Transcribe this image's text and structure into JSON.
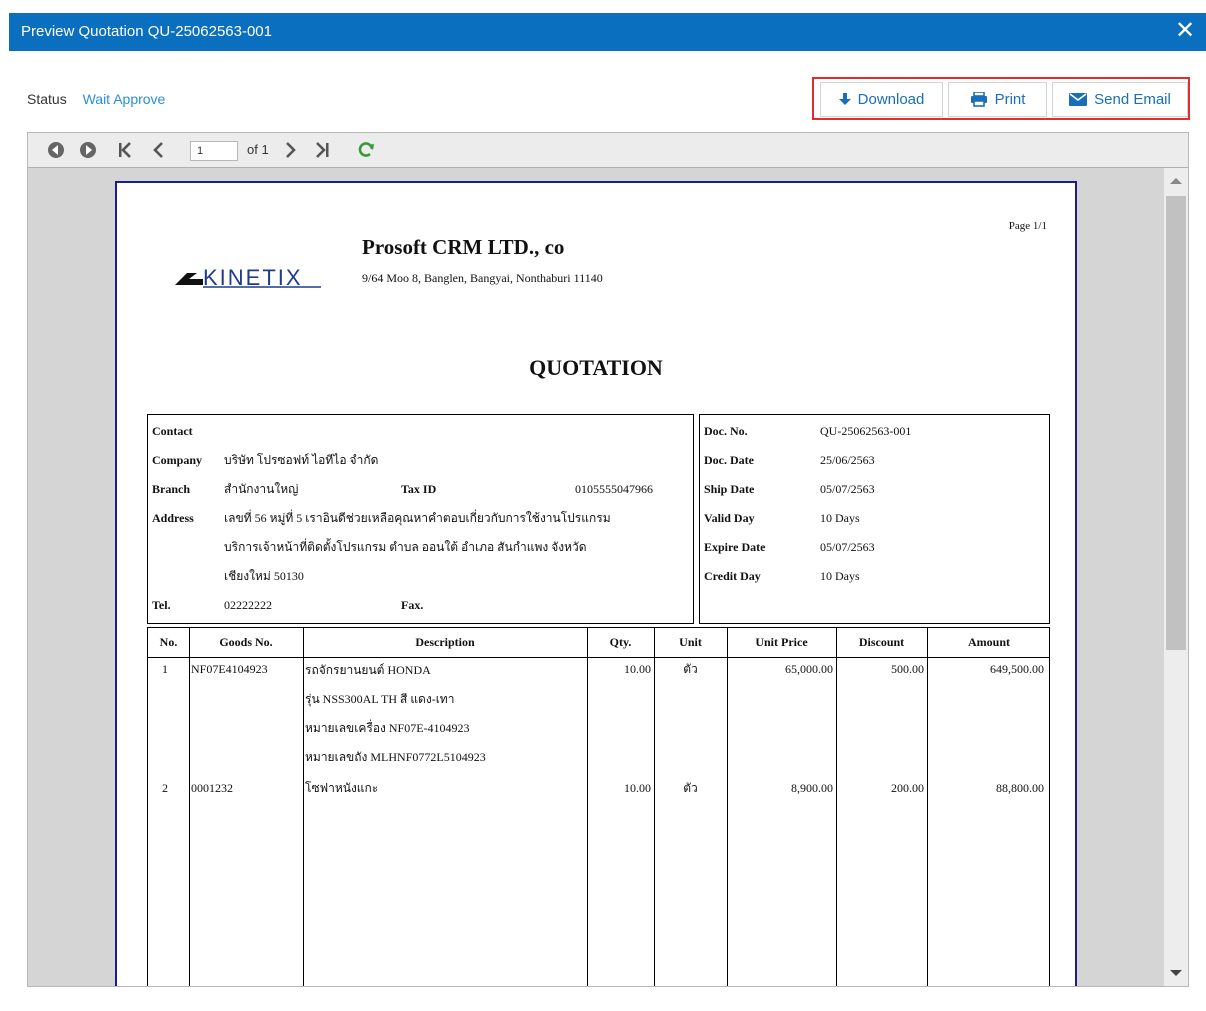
{
  "window": {
    "title": "Preview Quotation QU-25062563-001",
    "close_glyph": "✕"
  },
  "status": {
    "label": "Status",
    "value": "Wait Approve"
  },
  "actions": {
    "download": "Download",
    "print": "Print",
    "send_email": "Send Email"
  },
  "viewer": {
    "page_value": "1",
    "of_text": "of 1"
  },
  "document": {
    "page": "Page 1/1",
    "logo_text": "KINETIX",
    "company": "Prosoft CRM LTD., co",
    "address": "9/64 Moo 8, Banglen, Bangyai, Nonthaburi 11140",
    "title": "QUOTATION",
    "contact": {
      "contact_label": "Contact",
      "company_label": "Company",
      "company_value": "บริษัท โปรซอฟท์ ไอทีไอ จำกัด",
      "branch_label": "Branch",
      "branch_value": "สำนักงานใหญ่",
      "taxid_label": "Tax ID",
      "taxid_value": "0105555047966",
      "address_label": "Address",
      "address_line1": "เลขที่ 56 หมู่ที่ 5 เราอินดีช่วยเหลือคุณหาคำตอบเกี่ยวกับการใช้งานโปรแกรม",
      "address_line2": "บริการเจ้าหน้าที่ติดตั้งโปรแกรม ตำบล ออนใต้ อำเภอ สันกำแพง จังหวัด",
      "address_line3": "เชียงใหม่ 50130",
      "tel_label": "Tel.",
      "tel_value": "02222222",
      "fax_label": "Fax."
    },
    "info": {
      "docno_label": "Doc. No.",
      "docno_value": "QU-25062563-001",
      "docdate_label": "Doc. Date",
      "docdate_value": "25/06/2563",
      "shipdate_label": "Ship Date",
      "shipdate_value": "05/07/2563",
      "validday_label": "Valid Day",
      "validday_value": "10 Days",
      "expire_label": "Expire Date",
      "expire_value": "05/07/2563",
      "credit_label": "Credit Day",
      "credit_value": "10 Days"
    },
    "table": {
      "headers": [
        "No.",
        "Goods No.",
        "Description",
        "Qty.",
        "Unit",
        "Unit Price",
        "Discount",
        "Amount"
      ],
      "rows": [
        {
          "no": "1",
          "goods_no": "NF07E4104923",
          "desc1": "รถจักรยานยนต์ HONDA",
          "desc2": "รุ่น NSS300AL TH สี แดง-เทา",
          "desc3": "หมายเลขเครื่อง NF07E-4104923",
          "desc4": "หมายเลขถัง MLHNF0772L5104923",
          "qty": "10.00",
          "unit": "ตัว",
          "unit_price": "65,000.00",
          "discount": "500.00",
          "amount": "649,500.00"
        },
        {
          "no": "2",
          "goods_no": "0001232",
          "desc1": "โซฟาหนังแกะ",
          "qty": "10.00",
          "unit": "ตัว",
          "unit_price": "8,900.00",
          "discount": "200.00",
          "amount": "88,800.00"
        }
      ]
    }
  }
}
